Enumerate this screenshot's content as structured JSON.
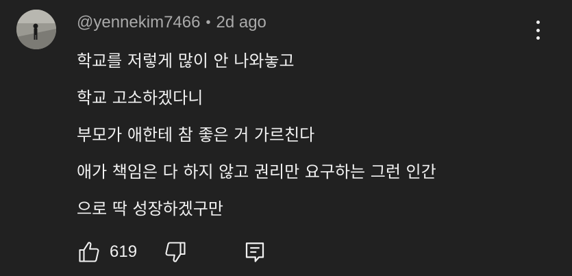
{
  "comment": {
    "author": "@yennekim7466",
    "separator": "•",
    "time": "2d ago",
    "lines": [
      "학교를 저렇게 많이 안 나와놓고",
      "학교 고소하겠다니",
      "부모가 애한테 참 좋은 거 가르친다",
      "애가 책임은 다 하지 않고 권리만 요구하는 그런 인간",
      "으로 딱 성장하겠구만"
    ],
    "like_count": "619"
  },
  "icons": {
    "menu": "more-vert-icon",
    "like": "thumbs-up-icon",
    "dislike": "thumbs-down-icon",
    "reply": "comment-reply-icon"
  },
  "colors": {
    "background": "#212121",
    "text": "#f1f1f1",
    "meta": "#aaaaaa"
  }
}
